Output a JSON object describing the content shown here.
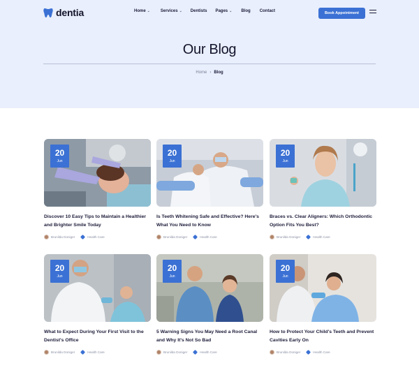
{
  "brand": {
    "name": "dentia"
  },
  "nav": [
    {
      "label": "Home",
      "dropdown": true
    },
    {
      "label": "Services",
      "dropdown": true
    },
    {
      "label": "Dentists",
      "dropdown": false
    },
    {
      "label": "Pages",
      "dropdown": true
    },
    {
      "label": "Blog",
      "dropdown": false
    },
    {
      "label": "Contact",
      "dropdown": false
    }
  ],
  "cta": {
    "label": "Book Appointment"
  },
  "page": {
    "title": "Our Blog"
  },
  "breadcrumb": {
    "home": "Home",
    "separator": "›",
    "current": "Blog"
  },
  "colors": {
    "accent": "#3b71d4",
    "hero_bg": "#e9effc",
    "text": "#1c1c3a"
  },
  "posts": [
    {
      "day": "20",
      "month": "Jun",
      "title": "Discover 10 Easy Tips to Maintain a Healthier and Brighter Smile Today",
      "author": "Brunilda Doniger",
      "category": "Health Care"
    },
    {
      "day": "20",
      "month": "Jun",
      "title": "Is Teeth Whitening Safe and Effective? Here's What You Need to Know",
      "author": "Brunilda Doniger",
      "category": "Health Care"
    },
    {
      "day": "20",
      "month": "Jun",
      "title": "Braces vs. Clear Aligners: Which Orthodontic Option Fits You Best?",
      "author": "Brunilda Doniger",
      "category": "Health Care"
    },
    {
      "day": "20",
      "month": "Jun",
      "title": "What to Expect During Your First Visit to the Dentist's Office",
      "author": "Brunilda Doniger",
      "category": "Health Care"
    },
    {
      "day": "20",
      "month": "Jun",
      "title": "5 Warning Signs You May Need a Root Canal and Why It's Not So Bad",
      "author": "Brunilda Doniger",
      "category": "Health Care"
    },
    {
      "day": "20",
      "month": "Jun",
      "title": "How to Protect Your Child's Teeth and Prevent Cavities Early On",
      "author": "Brunilda Doniger",
      "category": "Health Care"
    }
  ]
}
